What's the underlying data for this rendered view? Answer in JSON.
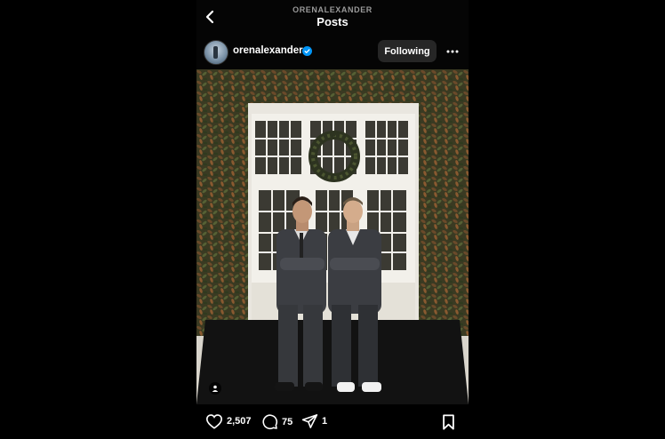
{
  "topbar": {
    "kicker": "ORENALEXANDER",
    "title": "Posts",
    "back_icon": "chevron-left-icon"
  },
  "post_header": {
    "username": "orenalexander",
    "verified": true,
    "follow_label": "Following",
    "more_icon": "more-horizontal-icon"
  },
  "photo": {
    "tagged_icon": "person-tag-icon"
  },
  "actions": {
    "likes": "2,507",
    "comments": "75",
    "shares": "1",
    "like_icon": "heart-icon",
    "comment_icon": "comment-icon",
    "share_icon": "send-icon",
    "save_icon": "bookmark-icon"
  },
  "colors": {
    "background": "#000000",
    "verified_badge": "#0095f6",
    "button_bg": "#262626"
  }
}
